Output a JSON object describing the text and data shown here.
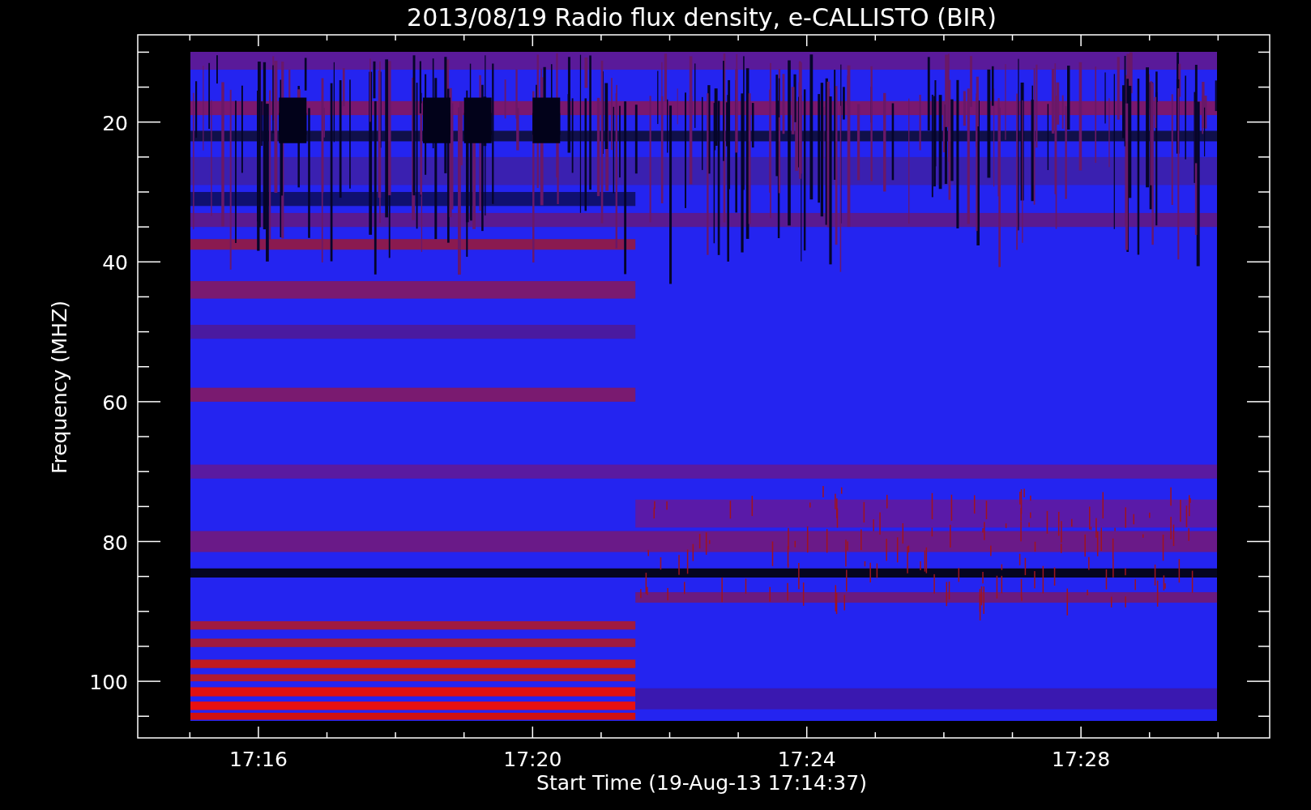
{
  "title": "2013/08/19  Radio flux density, e-CALLISTO (BIR)",
  "plot": {
    "ylabel": "Frequency (MHZ)",
    "xlabel": "Start Time (19-Aug-13 17:14:37)",
    "yticks": [
      {
        "label": "20"
      },
      {
        "label": "40"
      },
      {
        "label": "60"
      },
      {
        "label": "80"
      },
      {
        "label": "100"
      }
    ],
    "xticks": [
      {
        "label": "17:16"
      },
      {
        "label": "17:20"
      },
      {
        "label": "17:24"
      },
      {
        "label": "17:28"
      }
    ]
  }
}
